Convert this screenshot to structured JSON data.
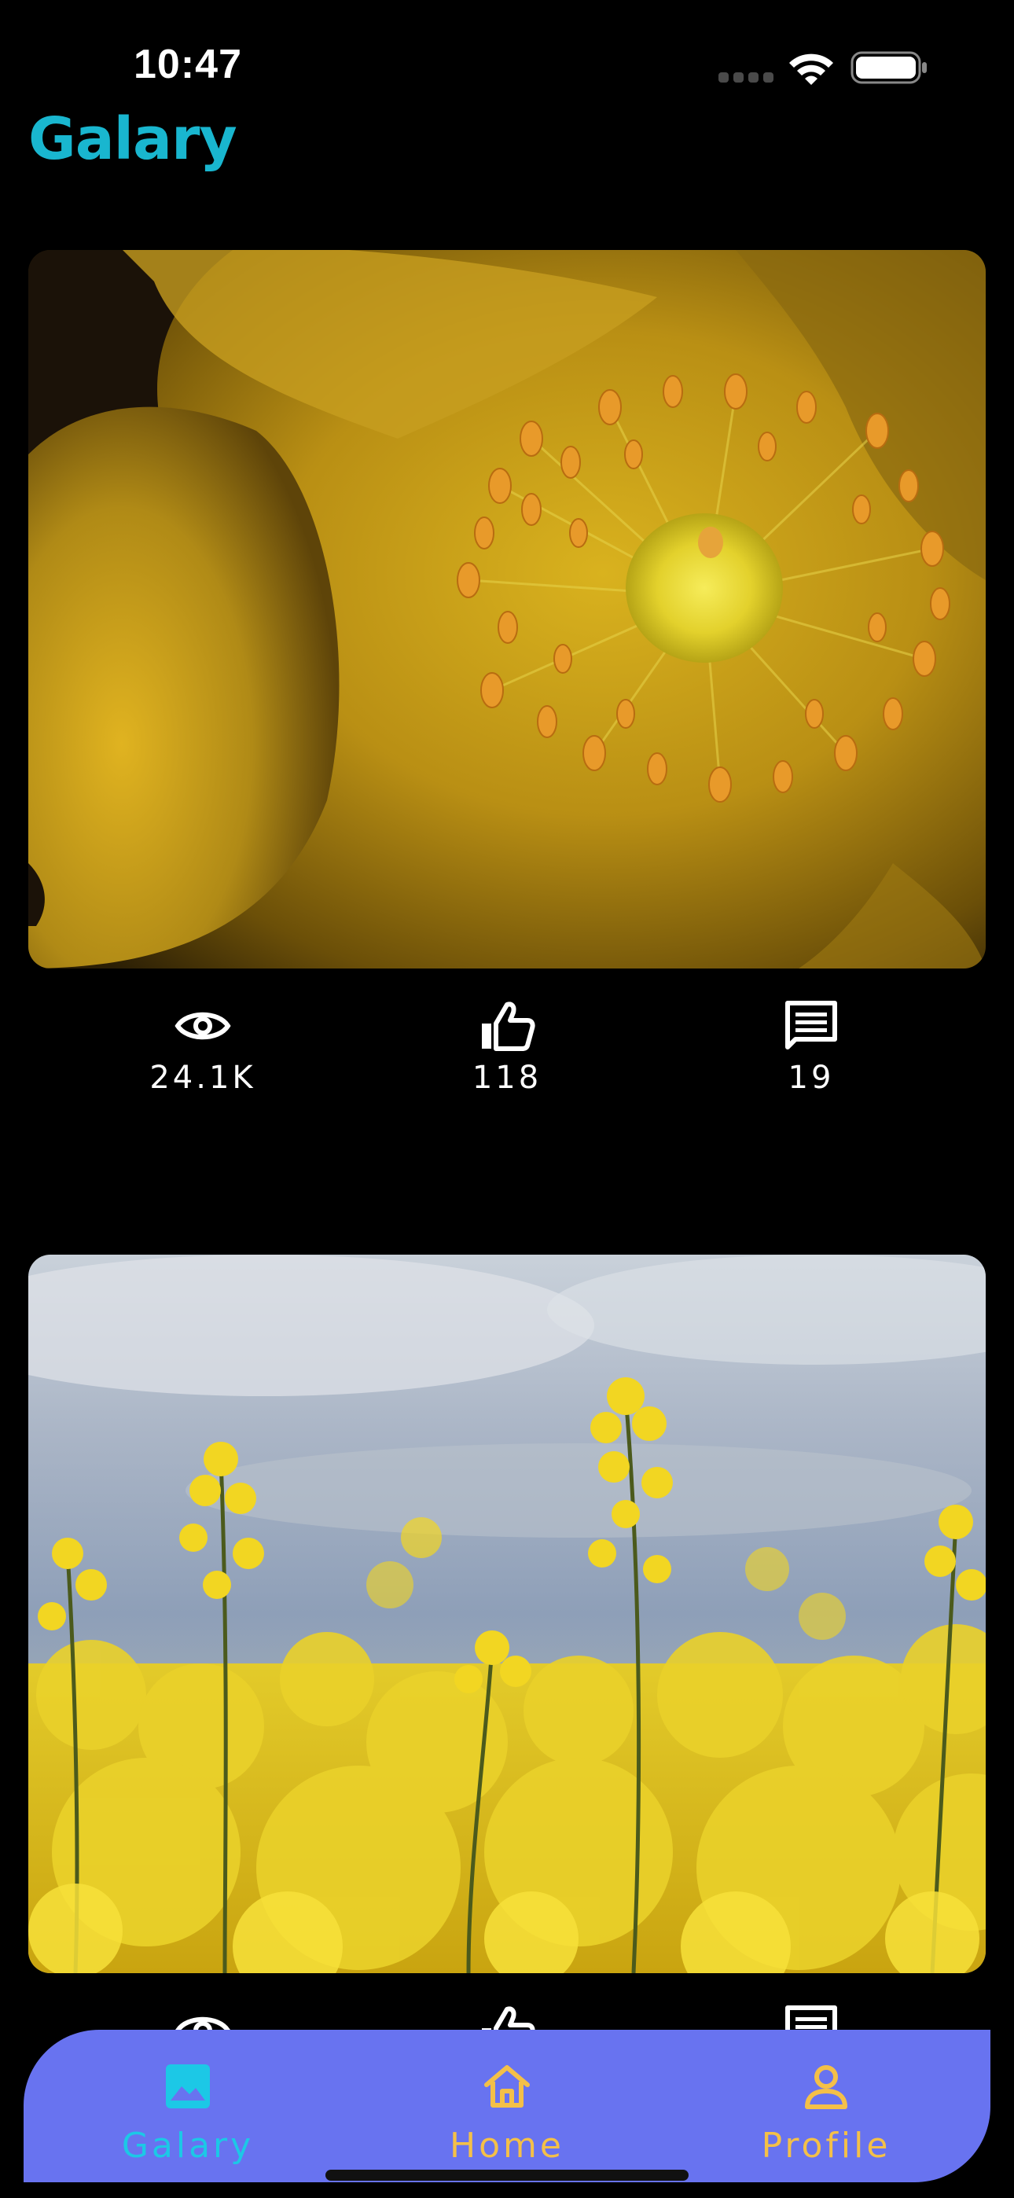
{
  "status_bar": {
    "time": "10:47"
  },
  "header": {
    "title": "Galary"
  },
  "posts": [
    {
      "views": "24.1K",
      "likes": "118",
      "comments": "19"
    },
    {
      "views": "",
      "likes": "",
      "comments": ""
    }
  ],
  "tab_bar": {
    "items": [
      {
        "label": "Galary",
        "icon": "image-icon",
        "active": true
      },
      {
        "label": "Home",
        "icon": "home-icon",
        "active": false
      },
      {
        "label": "Profile",
        "icon": "person-icon",
        "active": false
      }
    ],
    "colors": {
      "background": "#6873f0",
      "active": "#1cc8e6",
      "inactive": "#f4c048"
    }
  },
  "colors": {
    "title": "#19b6cf",
    "background": "#000000"
  }
}
